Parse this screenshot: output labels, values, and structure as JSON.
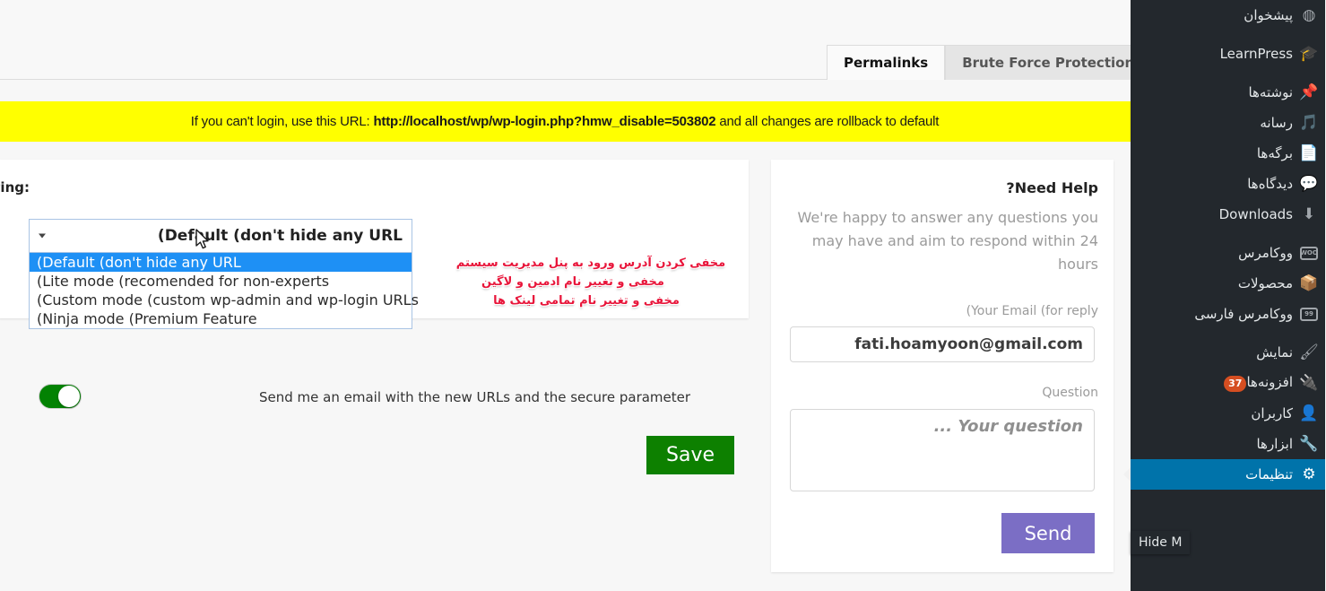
{
  "tabs": [
    {
      "label": "Brute Force Protection",
      "active": false
    },
    {
      "label": "Permalinks",
      "active": true
    }
  ],
  "notice": {
    "prefix": "If you can't login, use this URL: ",
    "url": "http://localhost/wp/wp-login.php?hmw_disable=503802",
    "suffix": " and all changes are rollback to default"
  },
  "settings_card": {
    "field_label": ":Default article/product sorting",
    "select": {
      "value": "(Default (don't hide any URL",
      "options": [
        "(Default (don't hide any URL",
        "(Lite mode (recomended for non-experts",
        "(Custom mode (custom wp-admin and wp-login URLs",
        "(Ninja mode (Premium Feature"
      ],
      "selected_index": 0
    },
    "toggle": {
      "label": "Send me an email with the new URLs and the secure parameter",
      "on": true,
      "on_color": "#038203"
    },
    "save_label": "Save",
    "save_color": "#0d8000"
  },
  "annotations": [
    "مخفی کردن آدرس ورود به پنل مدیریت سیستم",
    "مخفی و تغییر نام  ادمین و لاگین",
    "مخفی و تغییر نام تمامی لینک ها"
  ],
  "annotation_color": "#e8153a",
  "help_card": {
    "title": "?Need Help",
    "description": "We're happy to answer any questions you may have and aim to respond within 24 hours",
    "email_label": "(Your Email (for reply",
    "email_value": "fati.hoamyoon@gmail.com",
    "question_label": "Question",
    "question_placeholder": "... Your question",
    "question_value": "",
    "send_label": "Send",
    "send_color": "#7b6ec5"
  },
  "sidebar": {
    "background": "#23282d",
    "active_color": "#0073aa",
    "badge_color": "#d54e21",
    "items": [
      {
        "label": "پیشخوان",
        "icon": "dashboard-icon",
        "glyph": "◍",
        "active": false,
        "badge": null,
        "gap_before": false
      },
      {
        "label": "LearnPress",
        "icon": "graduation-cap-icon",
        "glyph": "🎓",
        "active": false,
        "badge": null,
        "gap_before": true
      },
      {
        "label": "نوشته‌ها",
        "icon": "pin-icon",
        "glyph": "📌",
        "active": false,
        "badge": null,
        "gap_before": true
      },
      {
        "label": "رسانه",
        "icon": "media-icon",
        "glyph": "🎵",
        "active": false,
        "badge": null,
        "gap_before": false
      },
      {
        "label": "برگه‌ها",
        "icon": "pages-icon",
        "glyph": "📄",
        "active": false,
        "badge": null,
        "gap_before": false
      },
      {
        "label": "دیدگاه‌ها",
        "icon": "comment-icon",
        "glyph": "💬",
        "active": false,
        "badge": null,
        "gap_before": false
      },
      {
        "label": "Downloads",
        "icon": "download-icon",
        "glyph": "⬇",
        "active": false,
        "badge": null,
        "gap_before": false
      },
      {
        "label": "ووکامرس",
        "icon": "woo-icon",
        "glyph": "woo",
        "active": false,
        "badge": null,
        "gap_before": true
      },
      {
        "label": "محصولات",
        "icon": "products-icon",
        "glyph": "📦",
        "active": false,
        "badge": null,
        "gap_before": false
      },
      {
        "label": "ووکامرس فارسی",
        "icon": "woo-fa-icon",
        "glyph": "99",
        "active": false,
        "badge": null,
        "gap_before": false
      },
      {
        "label": "نمایش",
        "icon": "appearance-icon",
        "glyph": "🖌",
        "active": false,
        "badge": null,
        "gap_before": true
      },
      {
        "label": "افزونه‌ها",
        "icon": "plugin-icon",
        "glyph": "🔌",
        "active": false,
        "badge": "37",
        "gap_before": false
      },
      {
        "label": "کاربران",
        "icon": "users-icon",
        "glyph": "👤",
        "active": false,
        "badge": null,
        "gap_before": false
      },
      {
        "label": "ابزارها",
        "icon": "tools-icon",
        "glyph": "🔧",
        "active": false,
        "badge": null,
        "gap_before": false
      },
      {
        "label": "تنظیمات",
        "icon": "settings-icon",
        "glyph": "⚙",
        "active": true,
        "badge": null,
        "gap_before": false
      }
    ],
    "tooltip": "Hide M"
  }
}
